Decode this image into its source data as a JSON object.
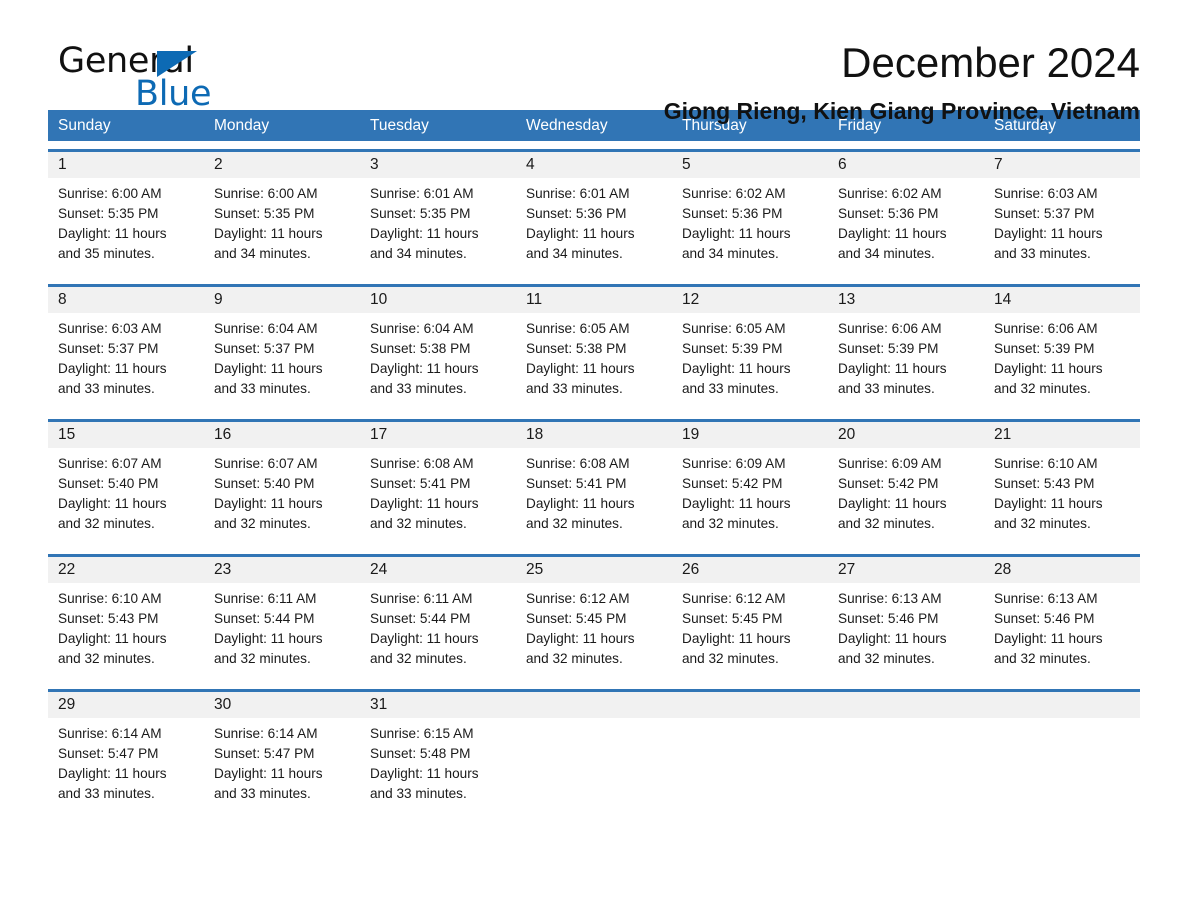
{
  "brand": {
    "name_part1": "General",
    "name_part2": "Blue",
    "triangle_icon": "brand-triangle-icon",
    "accent_color": "#0d6ab4"
  },
  "header": {
    "month_title": "December 2024",
    "location": "Giong Rieng, Kien Giang Province, Vietnam"
  },
  "theme": {
    "header_blue": "#3175b5",
    "row_divider_blue": "#3175b5",
    "date_band_gray": "#f1f1f1",
    "text_color": "#1a1a1a"
  },
  "calendar": {
    "weekdays": [
      "Sunday",
      "Monday",
      "Tuesday",
      "Wednesday",
      "Thursday",
      "Friday",
      "Saturday"
    ],
    "weeks": [
      {
        "days": [
          {
            "date": "1",
            "sunrise": "Sunrise: 6:00 AM",
            "sunset": "Sunset: 5:35 PM",
            "daylight_line1": "Daylight: 11 hours",
            "daylight_line2": "and 35 minutes."
          },
          {
            "date": "2",
            "sunrise": "Sunrise: 6:00 AM",
            "sunset": "Sunset: 5:35 PM",
            "daylight_line1": "Daylight: 11 hours",
            "daylight_line2": "and 34 minutes."
          },
          {
            "date": "3",
            "sunrise": "Sunrise: 6:01 AM",
            "sunset": "Sunset: 5:35 PM",
            "daylight_line1": "Daylight: 11 hours",
            "daylight_line2": "and 34 minutes."
          },
          {
            "date": "4",
            "sunrise": "Sunrise: 6:01 AM",
            "sunset": "Sunset: 5:36 PM",
            "daylight_line1": "Daylight: 11 hours",
            "daylight_line2": "and 34 minutes."
          },
          {
            "date": "5",
            "sunrise": "Sunrise: 6:02 AM",
            "sunset": "Sunset: 5:36 PM",
            "daylight_line1": "Daylight: 11 hours",
            "daylight_line2": "and 34 minutes."
          },
          {
            "date": "6",
            "sunrise": "Sunrise: 6:02 AM",
            "sunset": "Sunset: 5:36 PM",
            "daylight_line1": "Daylight: 11 hours",
            "daylight_line2": "and 34 minutes."
          },
          {
            "date": "7",
            "sunrise": "Sunrise: 6:03 AM",
            "sunset": "Sunset: 5:37 PM",
            "daylight_line1": "Daylight: 11 hours",
            "daylight_line2": "and 33 minutes."
          }
        ]
      },
      {
        "days": [
          {
            "date": "8",
            "sunrise": "Sunrise: 6:03 AM",
            "sunset": "Sunset: 5:37 PM",
            "daylight_line1": "Daylight: 11 hours",
            "daylight_line2": "and 33 minutes."
          },
          {
            "date": "9",
            "sunrise": "Sunrise: 6:04 AM",
            "sunset": "Sunset: 5:37 PM",
            "daylight_line1": "Daylight: 11 hours",
            "daylight_line2": "and 33 minutes."
          },
          {
            "date": "10",
            "sunrise": "Sunrise: 6:04 AM",
            "sunset": "Sunset: 5:38 PM",
            "daylight_line1": "Daylight: 11 hours",
            "daylight_line2": "and 33 minutes."
          },
          {
            "date": "11",
            "sunrise": "Sunrise: 6:05 AM",
            "sunset": "Sunset: 5:38 PM",
            "daylight_line1": "Daylight: 11 hours",
            "daylight_line2": "and 33 minutes."
          },
          {
            "date": "12",
            "sunrise": "Sunrise: 6:05 AM",
            "sunset": "Sunset: 5:39 PM",
            "daylight_line1": "Daylight: 11 hours",
            "daylight_line2": "and 33 minutes."
          },
          {
            "date": "13",
            "sunrise": "Sunrise: 6:06 AM",
            "sunset": "Sunset: 5:39 PM",
            "daylight_line1": "Daylight: 11 hours",
            "daylight_line2": "and 33 minutes."
          },
          {
            "date": "14",
            "sunrise": "Sunrise: 6:06 AM",
            "sunset": "Sunset: 5:39 PM",
            "daylight_line1": "Daylight: 11 hours",
            "daylight_line2": "and 32 minutes."
          }
        ]
      },
      {
        "days": [
          {
            "date": "15",
            "sunrise": "Sunrise: 6:07 AM",
            "sunset": "Sunset: 5:40 PM",
            "daylight_line1": "Daylight: 11 hours",
            "daylight_line2": "and 32 minutes."
          },
          {
            "date": "16",
            "sunrise": "Sunrise: 6:07 AM",
            "sunset": "Sunset: 5:40 PM",
            "daylight_line1": "Daylight: 11 hours",
            "daylight_line2": "and 32 minutes."
          },
          {
            "date": "17",
            "sunrise": "Sunrise: 6:08 AM",
            "sunset": "Sunset: 5:41 PM",
            "daylight_line1": "Daylight: 11 hours",
            "daylight_line2": "and 32 minutes."
          },
          {
            "date": "18",
            "sunrise": "Sunrise: 6:08 AM",
            "sunset": "Sunset: 5:41 PM",
            "daylight_line1": "Daylight: 11 hours",
            "daylight_line2": "and 32 minutes."
          },
          {
            "date": "19",
            "sunrise": "Sunrise: 6:09 AM",
            "sunset": "Sunset: 5:42 PM",
            "daylight_line1": "Daylight: 11 hours",
            "daylight_line2": "and 32 minutes."
          },
          {
            "date": "20",
            "sunrise": "Sunrise: 6:09 AM",
            "sunset": "Sunset: 5:42 PM",
            "daylight_line1": "Daylight: 11 hours",
            "daylight_line2": "and 32 minutes."
          },
          {
            "date": "21",
            "sunrise": "Sunrise: 6:10 AM",
            "sunset": "Sunset: 5:43 PM",
            "daylight_line1": "Daylight: 11 hours",
            "daylight_line2": "and 32 minutes."
          }
        ]
      },
      {
        "days": [
          {
            "date": "22",
            "sunrise": "Sunrise: 6:10 AM",
            "sunset": "Sunset: 5:43 PM",
            "daylight_line1": "Daylight: 11 hours",
            "daylight_line2": "and 32 minutes."
          },
          {
            "date": "23",
            "sunrise": "Sunrise: 6:11 AM",
            "sunset": "Sunset: 5:44 PM",
            "daylight_line1": "Daylight: 11 hours",
            "daylight_line2": "and 32 minutes."
          },
          {
            "date": "24",
            "sunrise": "Sunrise: 6:11 AM",
            "sunset": "Sunset: 5:44 PM",
            "daylight_line1": "Daylight: 11 hours",
            "daylight_line2": "and 32 minutes."
          },
          {
            "date": "25",
            "sunrise": "Sunrise: 6:12 AM",
            "sunset": "Sunset: 5:45 PM",
            "daylight_line1": "Daylight: 11 hours",
            "daylight_line2": "and 32 minutes."
          },
          {
            "date": "26",
            "sunrise": "Sunrise: 6:12 AM",
            "sunset": "Sunset: 5:45 PM",
            "daylight_line1": "Daylight: 11 hours",
            "daylight_line2": "and 32 minutes."
          },
          {
            "date": "27",
            "sunrise": "Sunrise: 6:13 AM",
            "sunset": "Sunset: 5:46 PM",
            "daylight_line1": "Daylight: 11 hours",
            "daylight_line2": "and 32 minutes."
          },
          {
            "date": "28",
            "sunrise": "Sunrise: 6:13 AM",
            "sunset": "Sunset: 5:46 PM",
            "daylight_line1": "Daylight: 11 hours",
            "daylight_line2": "and 32 minutes."
          }
        ]
      },
      {
        "days": [
          {
            "date": "29",
            "sunrise": "Sunrise: 6:14 AM",
            "sunset": "Sunset: 5:47 PM",
            "daylight_line1": "Daylight: 11 hours",
            "daylight_line2": "and 33 minutes."
          },
          {
            "date": "30",
            "sunrise": "Sunrise: 6:14 AM",
            "sunset": "Sunset: 5:47 PM",
            "daylight_line1": "Daylight: 11 hours",
            "daylight_line2": "and 33 minutes."
          },
          {
            "date": "31",
            "sunrise": "Sunrise: 6:15 AM",
            "sunset": "Sunset: 5:48 PM",
            "daylight_line1": "Daylight: 11 hours",
            "daylight_line2": "and 33 minutes."
          },
          {
            "date": "",
            "sunrise": "",
            "sunset": "",
            "daylight_line1": "",
            "daylight_line2": ""
          },
          {
            "date": "",
            "sunrise": "",
            "sunset": "",
            "daylight_line1": "",
            "daylight_line2": ""
          },
          {
            "date": "",
            "sunrise": "",
            "sunset": "",
            "daylight_line1": "",
            "daylight_line2": ""
          },
          {
            "date": "",
            "sunrise": "",
            "sunset": "",
            "daylight_line1": "",
            "daylight_line2": ""
          }
        ]
      }
    ]
  }
}
